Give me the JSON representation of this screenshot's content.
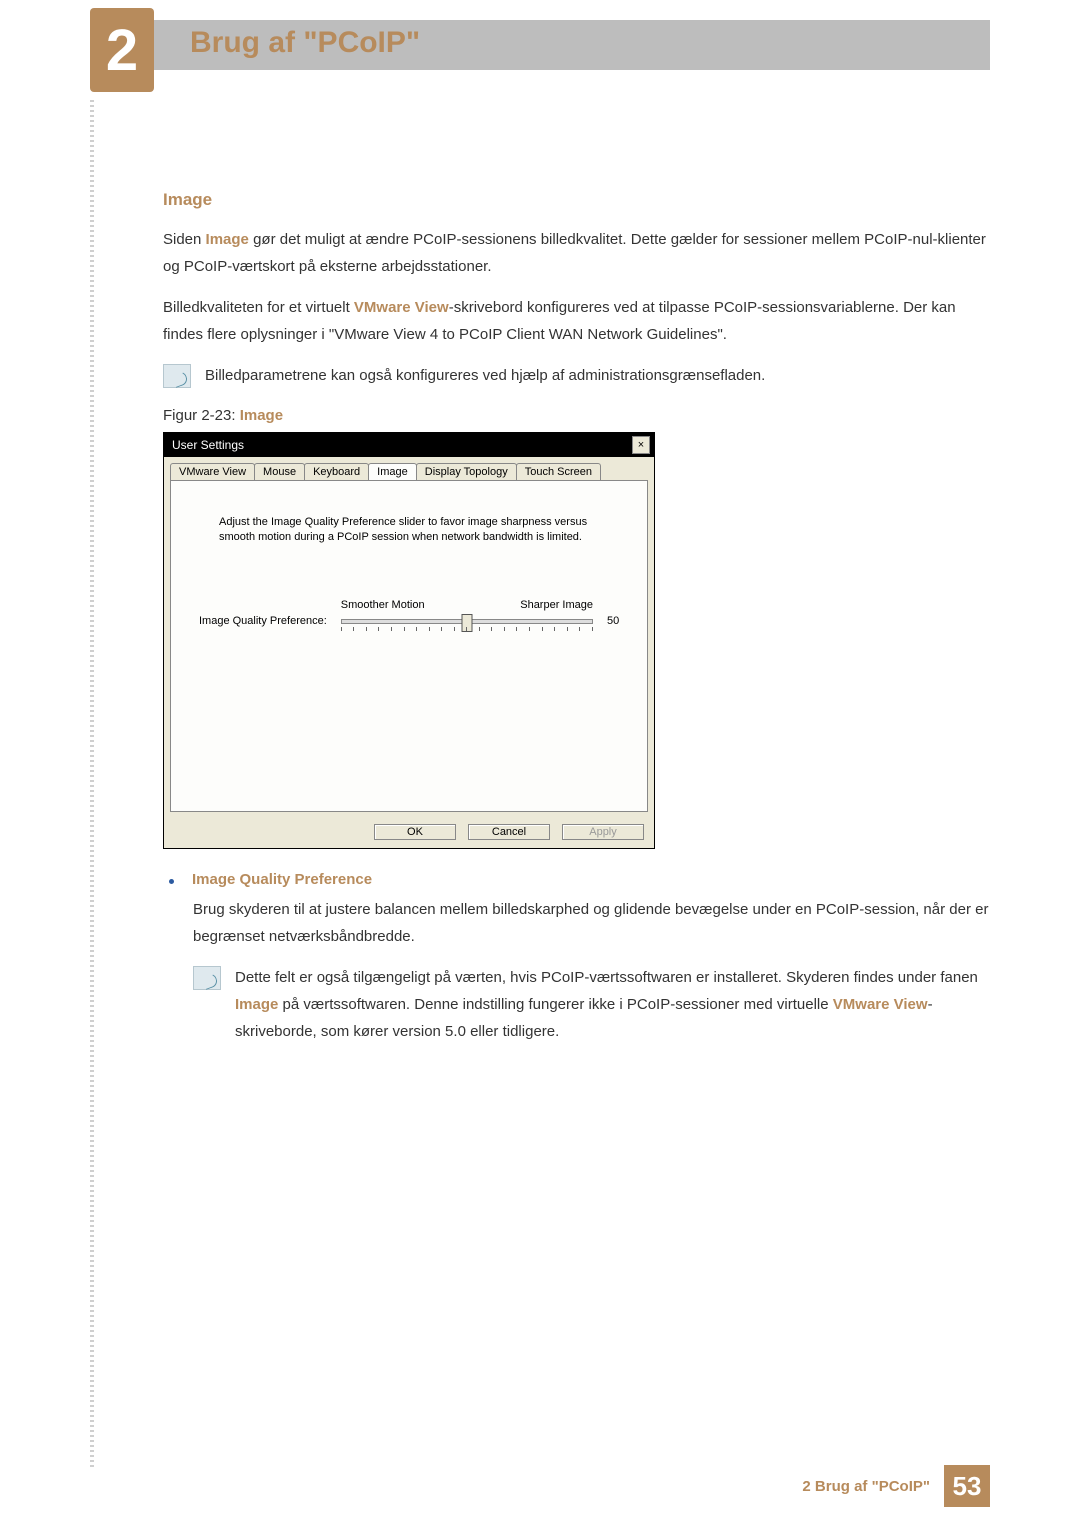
{
  "chapter": {
    "number": "2",
    "title": "Brug af \"PCoIP\""
  },
  "section": {
    "heading": "Image"
  },
  "paras": {
    "p1_a": "Siden ",
    "p1_kw": "Image",
    "p1_b": " gør det muligt at ændre PCoIP-sessionens billedkvalitet. Dette gælder for sessioner mellem PCoIP-nul-klienter og PCoIP-værtskort på eksterne arbejdsstationer.",
    "p2_a": "Billedkvaliteten for et virtuelt ",
    "p2_kw": "VMware View",
    "p2_b": "-skrivebord konfigureres ved at tilpasse PCoIP-sessionsvariablerne. Der kan findes flere oplysninger i \"VMware View 4 to PCoIP Client WAN Network Guidelines\".",
    "note1": "Billedparametrene kan også konfigureres ved hjælp af administrationsgrænsefladen.",
    "figure_prefix": "Figur 2-23: ",
    "figure_kw": "Image"
  },
  "window": {
    "title": "User Settings",
    "close": "×",
    "tabs": [
      "VMware View",
      "Mouse",
      "Keyboard",
      "Image",
      "Display Topology",
      "Touch Screen"
    ],
    "active_tab_index": 3,
    "pane_desc": "Adjust the Image Quality Preference slider to favor image sharpness versus smooth motion during a PCoIP session when network bandwidth is limited.",
    "slider": {
      "label": "Image Quality Preference:",
      "left": "Smoother Motion",
      "right": "Sharper Image",
      "value": "50"
    },
    "buttons": {
      "ok": "OK",
      "cancel": "Cancel",
      "apply": "Apply"
    }
  },
  "bullet": {
    "title": "Image Quality Preference",
    "body": "Brug skyderen til at justere balancen mellem billedskarphed og glidende bevægelse under en PCoIP-session, når der er begrænset netværksbåndbredde.",
    "note_a": "Dette felt er også tilgængeligt på værten, hvis PCoIP-værtssoftwaren er installeret. Skyderen findes under fanen ",
    "note_kw1": "Image",
    "note_b": " på værtssoftwaren. Denne indstilling fungerer ikke i PCoIP-sessioner med virtuelle ",
    "note_kw2": "VMware View",
    "note_c": "-skriveborde, som kører version 5.0 eller tidligere."
  },
  "footer": {
    "label": "2 Brug af \"PCoIP\"",
    "page": "53"
  }
}
